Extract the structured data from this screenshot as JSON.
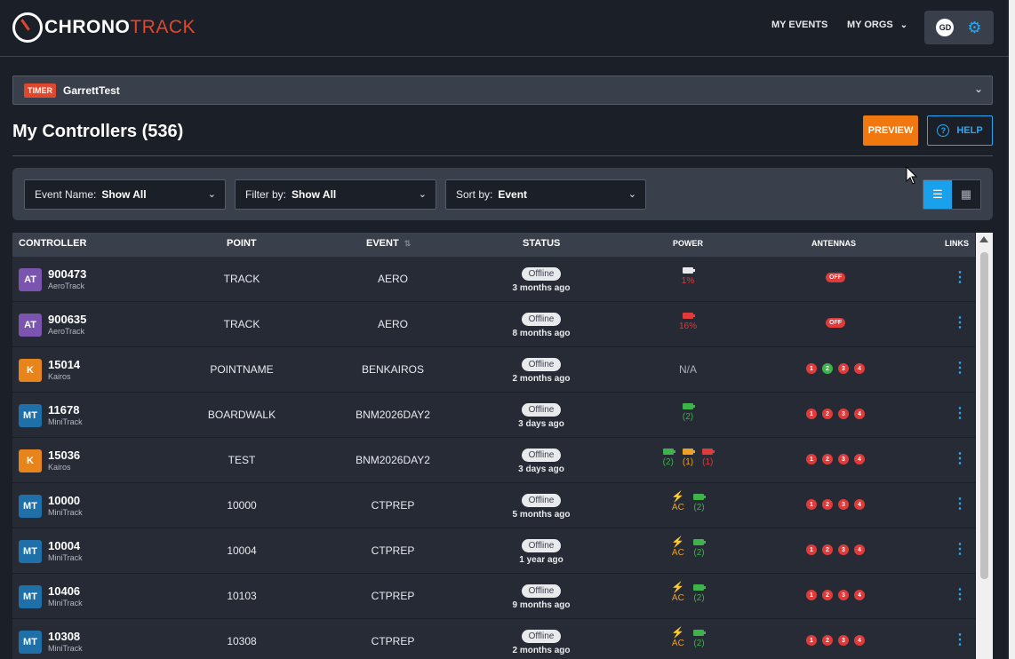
{
  "app": {
    "logo_part1": "CHRONO",
    "logo_part2": "TRACK"
  },
  "header": {
    "nav_events": "MY EVENTS",
    "nav_orgs": "MY ORGS",
    "user_initials": "GD"
  },
  "timer": {
    "badge": "TIMER",
    "name": "GarrettTest"
  },
  "page": {
    "title": "My Controllers (536)",
    "preview_label": "PREVIEW",
    "help_label": "HELP"
  },
  "filters": {
    "event_name_label": "Event Name:",
    "event_name_value": "Show All",
    "filter_by_label": "Filter by:",
    "filter_by_value": "Show All",
    "sort_by_label": "Sort by:",
    "sort_by_value": "Event"
  },
  "table": {
    "columns": {
      "controller": "CONTROLLER",
      "point": "POINT",
      "event": "EVENT",
      "status": "STATUS",
      "power": "POWER",
      "antennas": "ANTENNAS",
      "links": "LINKS"
    },
    "rows": [
      {
        "badge": "AT",
        "badge_color": "#7b54b0",
        "id": "900473",
        "type": "AeroTrack",
        "point": "TRACK",
        "event": "AERO",
        "status": "Offline",
        "time": "3 months ago"
      },
      {
        "badge": "AT",
        "badge_color": "#7b54b0",
        "id": "900635",
        "type": "AeroTrack",
        "point": "TRACK",
        "event": "AERO",
        "status": "Offline",
        "time": "8 months ago"
      },
      {
        "badge": "K",
        "badge_color": "#e8841c",
        "id": "15014",
        "type": "Kairos",
        "point": "POINTNAME",
        "event": "BENKAIROS",
        "status": "Offline",
        "time": "2 months ago"
      },
      {
        "badge": "MT",
        "badge_color": "#1f6fa8",
        "id": "11678",
        "type": "MiniTrack",
        "point": "BOARDWALK",
        "event": "BNM2026DAY2",
        "status": "Offline",
        "time": "3 days ago"
      },
      {
        "badge": "K",
        "badge_color": "#e8841c",
        "id": "15036",
        "type": "Kairos",
        "point": "TEST",
        "event": "BNM2026DAY2",
        "status": "Offline",
        "time": "3 days ago"
      },
      {
        "badge": "MT",
        "badge_color": "#1f6fa8",
        "id": "10000",
        "type": "MiniTrack",
        "point": "10000",
        "event": "CTPREP",
        "status": "Offline",
        "time": "5 months ago"
      },
      {
        "badge": "MT",
        "badge_color": "#1f6fa8",
        "id": "10004",
        "type": "MiniTrack",
        "point": "10004",
        "event": "CTPREP",
        "status": "Offline",
        "time": "1 year ago"
      },
      {
        "badge": "MT",
        "badge_color": "#1f6fa8",
        "id": "10406",
        "type": "MiniTrack",
        "point": "10103",
        "event": "CTPREP",
        "status": "Offline",
        "time": "9 months ago"
      },
      {
        "badge": "MT",
        "badge_color": "#1f6fa8",
        "id": "10308",
        "type": "MiniTrack",
        "point": "10308",
        "event": "CTPREP",
        "status": "Offline",
        "time": "2 months ago"
      }
    ],
    "power": {
      "r0": {
        "text": "1%",
        "color": "#e03b3b",
        "batt": "#e9eaec"
      },
      "r1": {
        "text": "16%",
        "color": "#e03b3b",
        "batt": "#e03b3b"
      },
      "r2": {
        "na": "N/A"
      },
      "r3": {
        "text": "(2)",
        "color": "#3db34a",
        "batt": "#3db34a"
      },
      "r4": [
        {
          "text": "(2)",
          "color": "#3db34a"
        },
        {
          "text": "(1)",
          "color": "#f0a020"
        },
        {
          "text": "(1)",
          "color": "#e03b3b"
        }
      ],
      "ac_label": "AC",
      "dc_label": "(2)"
    },
    "antennas": {
      "off_label": "OFF",
      "labels": [
        "1",
        "2",
        "3",
        "4"
      ],
      "red": "#e03b3b",
      "green": "#3db34a"
    }
  },
  "colors": {
    "accent_blue": "#2aa8f2",
    "preview_orange": "#f0780f",
    "brand_red": "#e0482d"
  }
}
